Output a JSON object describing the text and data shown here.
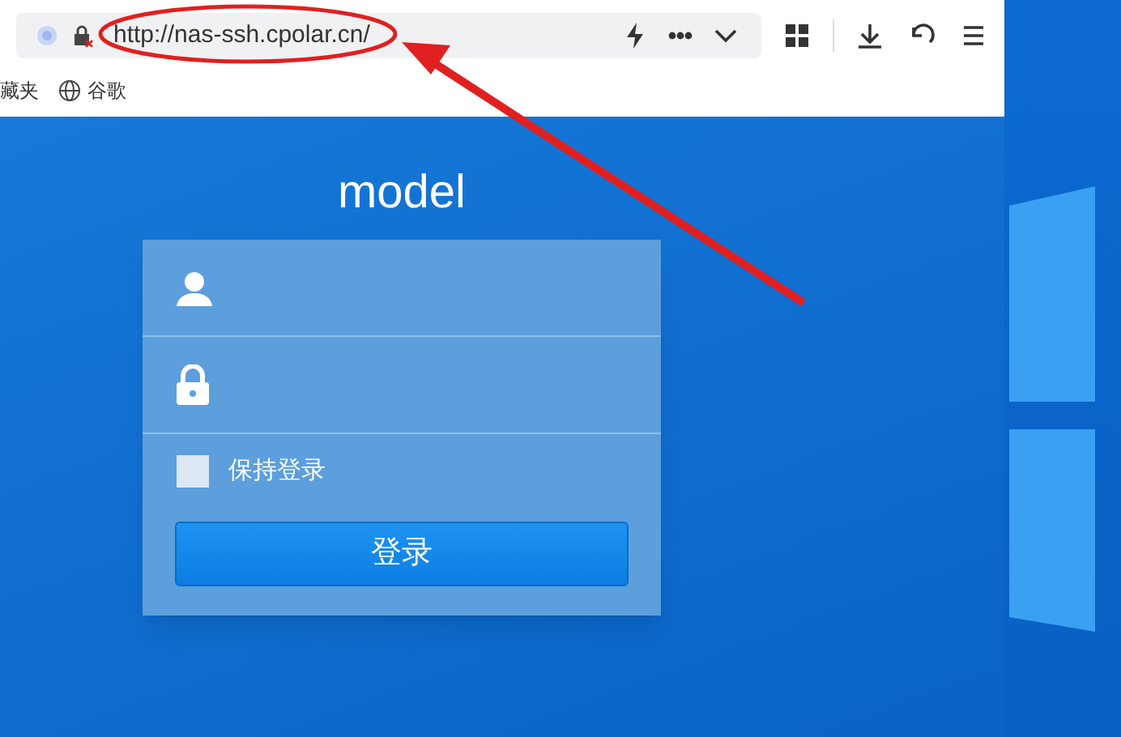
{
  "browser": {
    "url": "http://nas-ssh.cpolar.cn/",
    "bookmarks": [
      {
        "label": "藏夹",
        "kind": "text"
      },
      {
        "label": "谷歌",
        "kind": "globe"
      }
    ]
  },
  "page": {
    "title": "model",
    "fields": [
      {
        "kind": "user"
      },
      {
        "kind": "lock"
      }
    ],
    "remember": {
      "label": "保持登录",
      "checked": false
    },
    "submit": "登录"
  }
}
